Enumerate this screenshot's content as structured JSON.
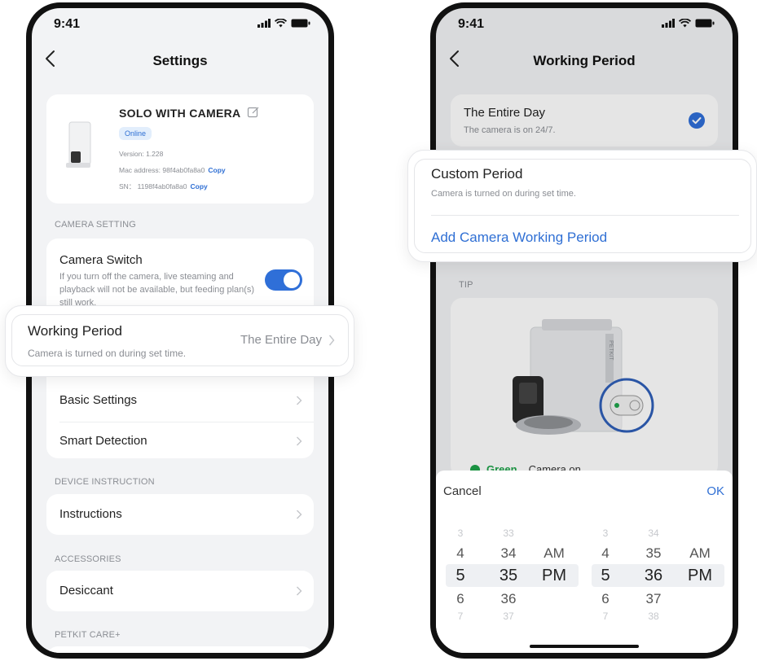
{
  "left_phone": {
    "status": {
      "time": "9:41"
    },
    "nav": {
      "title": "Settings"
    },
    "device": {
      "name": "SOLO WITH CAMERA",
      "status_badge": "Online",
      "version": "Version: 1.228",
      "mac": "Mac address: 98f4ab0fa8a0",
      "sn": "SN： 1198f4ab0fa8a0",
      "copy_label": "Copy"
    },
    "camera_section": {
      "label": "CAMERA SETTING",
      "switch_title": "Camera Switch",
      "switch_desc": "If you turn off the camera, live steaming and playback will not be available, but feeding plan(s) still work.",
      "switch_on": true
    },
    "working_period": {
      "title": "Working Period",
      "desc": "Camera is turned on during set time.",
      "value": "The Entire Day"
    },
    "rows": {
      "basic": "Basic Settings",
      "smart": "Smart Detection"
    },
    "device_instruction": {
      "label": "DEVICE INSTRUCTION",
      "instructions": "Instructions"
    },
    "accessories": {
      "label": "ACCESSORIES",
      "desiccant": "Desiccant"
    },
    "care": {
      "label": "PETKIT CARE+"
    }
  },
  "right_phone": {
    "status": {
      "time": "9:41"
    },
    "nav": {
      "title": "Working Period"
    },
    "entire_day": {
      "title": "The Entire Day",
      "desc": "The camera is on 24/7.",
      "selected": true
    },
    "custom": {
      "title": "Custom Period",
      "desc": "Camera is turned on during set time.",
      "add_label": "Add Camera Working Period"
    },
    "tip": {
      "label": "TIP",
      "legend_color_label": "Green",
      "legend_text": "Camera on",
      "brand_text": "PETKIT"
    },
    "picker": {
      "cancel": "Cancel",
      "ok": "OK",
      "start": {
        "hours": [
          "3",
          "4",
          "5",
          "6",
          "7"
        ],
        "minutes": [
          "33",
          "34",
          "35",
          "36",
          "37"
        ],
        "ampm": [
          "AM",
          "PM"
        ]
      },
      "end": {
        "hours": [
          "3",
          "4",
          "5",
          "6",
          "7"
        ],
        "minutes": [
          "34",
          "35",
          "36",
          "37",
          "38"
        ],
        "ampm": [
          "AM",
          "PM"
        ]
      },
      "selected": {
        "start": {
          "hour": "5",
          "minute": "35",
          "ampm": "PM"
        },
        "end": {
          "hour": "5",
          "minute": "36",
          "ampm": "PM"
        }
      }
    }
  },
  "colors": {
    "accent": "#2f6fd8",
    "link": "#2f6fd4",
    "green": "#1fa34a",
    "background": "#f2f3f5"
  }
}
